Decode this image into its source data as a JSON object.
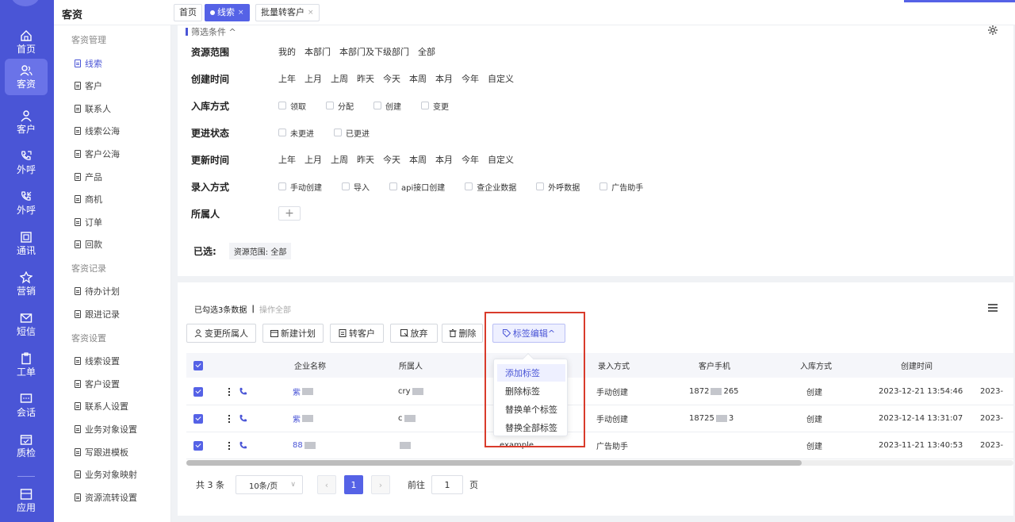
{
  "app": {
    "title": "客资"
  },
  "tabs": [
    {
      "label": "首页",
      "active": false,
      "closable": false
    },
    {
      "label": "线索",
      "active": true,
      "closable": true
    },
    {
      "label": "批量转客户",
      "active": false,
      "closable": true
    }
  ],
  "iconbar": [
    {
      "label": "首页",
      "icon": "home-icon"
    },
    {
      "label": "客资",
      "icon": "users-icon",
      "active": true
    },
    {
      "label": "客户",
      "icon": "person-icon"
    },
    {
      "label": "外呼",
      "icon": "phone-out-icon"
    },
    {
      "label": "外呼",
      "icon": "phone-in-icon"
    },
    {
      "label": "通讯",
      "icon": "contacts-icon"
    },
    {
      "label": "营销",
      "icon": "marketing-icon"
    },
    {
      "label": "短信",
      "icon": "sms-icon"
    },
    {
      "label": "工单",
      "icon": "clipboard-icon"
    },
    {
      "label": "会话",
      "icon": "chat-icon"
    },
    {
      "label": "质检",
      "icon": "calendar-check-icon"
    },
    {
      "label": "应用",
      "icon": "apps-icon"
    }
  ],
  "subnav": {
    "groups": [
      {
        "title": "客资管理",
        "items": [
          "线索",
          "客户",
          "联系人",
          "线索公海",
          "客户公海",
          "产品",
          "商机",
          "订单",
          "回款"
        ]
      },
      {
        "title": "客资记录",
        "items": [
          "待办计划",
          "跟进记录"
        ]
      },
      {
        "title": "客资设置",
        "items": [
          "线索设置",
          "客户设置",
          "联系人设置",
          "业务对象设置",
          "写跟进模板",
          "业务对象映射",
          "资源流转设置"
        ]
      }
    ]
  },
  "filter": {
    "title": "筛选条件 ^",
    "rows": [
      {
        "label": "资源范围",
        "type": "text",
        "options": [
          "我的",
          "本部门",
          "本部门及下级部门",
          "全部"
        ]
      },
      {
        "label": "创建时间",
        "type": "text",
        "options": [
          "上年",
          "上月",
          "上周",
          "昨天",
          "今天",
          "本周",
          "本月",
          "今年",
          "自定义"
        ]
      },
      {
        "label": "入库方式",
        "type": "check",
        "options": [
          "领取",
          "分配",
          "创建",
          "变更"
        ]
      },
      {
        "label": "更进状态",
        "type": "check",
        "options": [
          "未更进",
          "已更进"
        ]
      },
      {
        "label": "更新时间",
        "type": "text",
        "options": [
          "上年",
          "上月",
          "上周",
          "昨天",
          "今天",
          "本周",
          "本月",
          "今年",
          "自定义"
        ]
      },
      {
        "label": "录入方式",
        "type": "check",
        "options": [
          "手动创建",
          "导入",
          "api接口创建",
          "查企业数据",
          "外呼数据",
          "广告助手"
        ]
      },
      {
        "label": "所属人",
        "type": "plus",
        "options": []
      }
    ],
    "selected_label": "已选:",
    "selected_chip": "资源范围: 全部"
  },
  "data": {
    "selected_info": "已勾选3条数据",
    "select_all": "操作全部",
    "buttons": [
      "变更所属人",
      "新建计划",
      "转客户",
      "放弃",
      "删除",
      "标签编辑^"
    ],
    "columns": [
      "企业名称",
      "所属人",
      "录入方式",
      "客户手机",
      "入库方式",
      "创建时间"
    ],
    "rows": [
      {
        "company": "紫",
        "owner": "cry",
        "source": "手动创建",
        "phone_a": "1872",
        "phone_b": "265",
        "entry": "创建",
        "created": "2023-12-21 13:54:46",
        "extra": "2023-"
      },
      {
        "company": "紫",
        "owner": "c",
        "source": "手动创建",
        "phone_a": "18725",
        "phone_b": "3",
        "entry": "创建",
        "created": "2023-12-14 13:31:07",
        "extra": "2023-"
      },
      {
        "company": "88",
        "owner": "",
        "owner_tail": "example",
        "source": "广告助手",
        "phone_a": "",
        "phone_b": "",
        "entry": "创建",
        "created": "2023-11-21 13:40:53",
        "extra": "2023-"
      }
    ],
    "pager": {
      "total": "共 3 条",
      "size": "10条/页",
      "page": "1",
      "goto_label": "前往",
      "goto_value": "1",
      "page_suffix": "页"
    }
  },
  "dropdown": {
    "items": [
      "添加标签",
      "删除标签",
      "替换单个标签",
      "替换全部标签"
    ],
    "highlight": 0
  },
  "colors": {
    "brand": "#4a55d6",
    "highlight_box": "#d93b2b"
  }
}
